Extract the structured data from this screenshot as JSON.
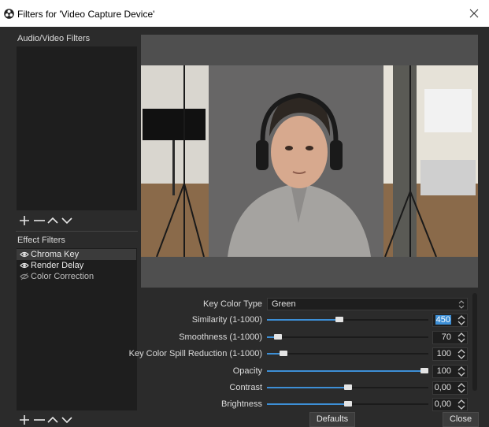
{
  "window": {
    "title": "Filters for 'Video Capture Device'"
  },
  "audio_video": {
    "label": "Audio/Video Filters"
  },
  "effect": {
    "label": "Effect Filters",
    "items": [
      {
        "label": "Chroma Key",
        "enabled": true
      },
      {
        "label": "Render Delay",
        "enabled": true
      },
      {
        "label": "Color Correction",
        "enabled": false
      }
    ]
  },
  "toolbar_icons": [
    "plus-icon",
    "minus-icon",
    "chevron-up-icon",
    "chevron-down-icon"
  ],
  "properties": {
    "key_color_type": {
      "label": "Key Color Type",
      "value": "Green"
    },
    "similarity": {
      "label": "Similarity (1-1000)",
      "value": "450",
      "level": 0.45
    },
    "smoothness": {
      "label": "Smoothness (1-1000)",
      "value": "70",
      "level": 0.07
    },
    "spill": {
      "label": "Key Color Spill Reduction (1-1000)",
      "value": "100",
      "level": 0.1
    },
    "opacity": {
      "label": "Opacity",
      "value": "100",
      "level": 1.0
    },
    "contrast": {
      "label": "Contrast",
      "value": "0,00",
      "level": 0.5
    },
    "brightness": {
      "label": "Brightness",
      "value": "0,00",
      "level": 0.5
    }
  },
  "buttons": {
    "defaults": "Defaults",
    "close": "Close"
  },
  "colors": {
    "accent": "#3d8fd6",
    "panel": "#2b2b2b",
    "list": "#1e1e1e"
  }
}
